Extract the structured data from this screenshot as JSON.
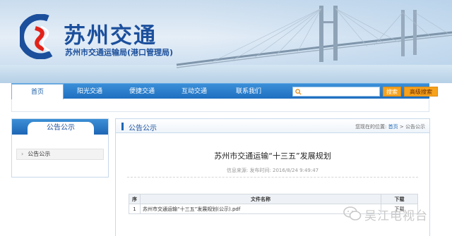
{
  "header": {
    "brand_title": "苏州交通",
    "brand_subtitle": "苏州市交通运输局(港口管理局)",
    "brand_color": "#1b4f9c"
  },
  "nav": {
    "items": [
      {
        "label": "首页",
        "active": true
      },
      {
        "label": "阳光交通"
      },
      {
        "label": "便捷交通"
      },
      {
        "label": "互动交通"
      },
      {
        "label": "联系我们"
      }
    ],
    "search_placeholder": "",
    "search_button": "搜索",
    "advanced_search_button": "高级搜索",
    "accent_color": "#f6a21d"
  },
  "sidebar": {
    "title": "公告公示",
    "items": [
      {
        "label": "公告公示"
      }
    ]
  },
  "main": {
    "section_title": "公告公示",
    "breadcrumb": {
      "prefix": "您现在的位置:",
      "home": "首页",
      "separator": ">",
      "current": "公告公示"
    },
    "article": {
      "title": "苏州市交通运输“十三五”发展规划",
      "meta": "信息来源:  发布时间: 2016/8/24 9:49:47"
    },
    "files_table": {
      "headers": [
        "序",
        "文件名称",
        "下载"
      ],
      "rows": [
        {
          "index": "1",
          "name": "苏州市交通运输“十三五”发展规划(公示).pdf",
          "download": "下载"
        }
      ]
    }
  },
  "watermark": {
    "text": "吴江电视台"
  }
}
